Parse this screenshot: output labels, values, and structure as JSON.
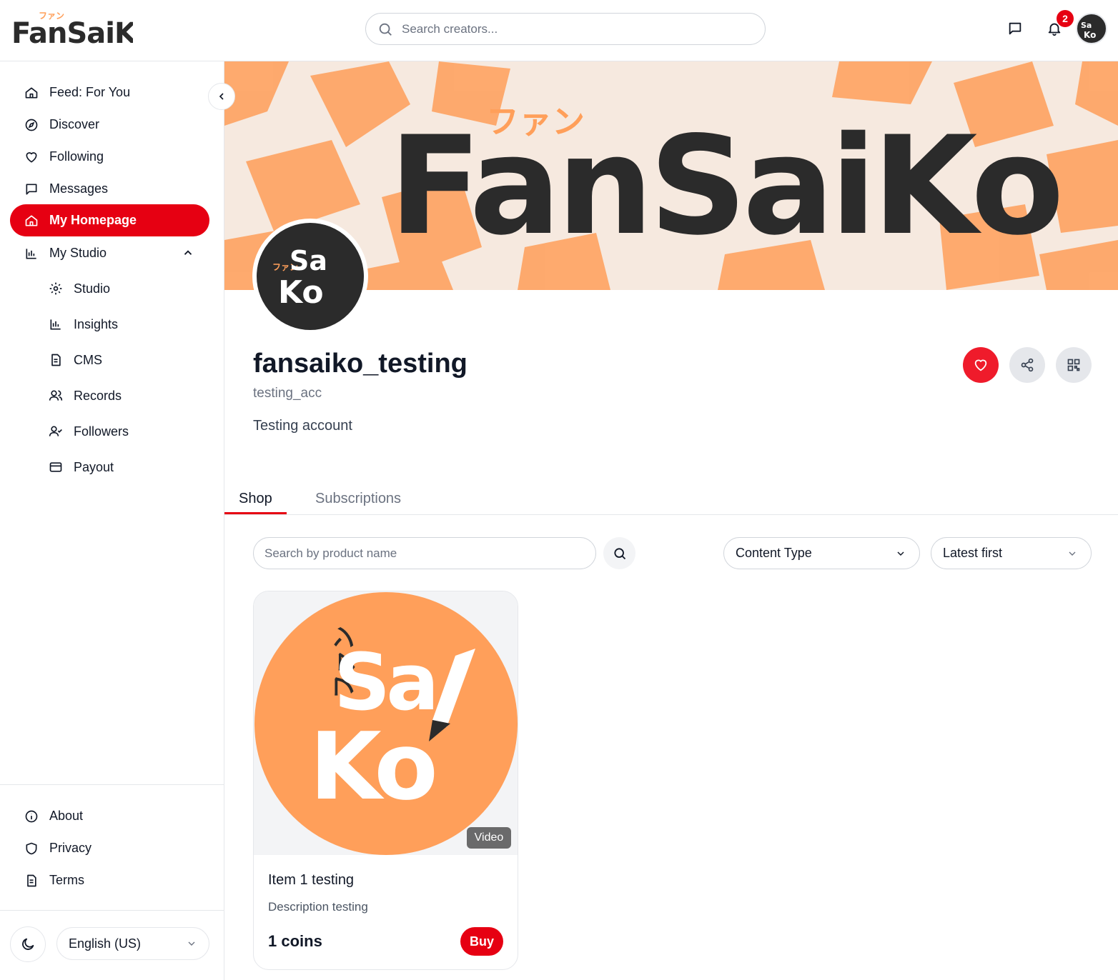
{
  "app": {
    "brand": "FanSaiKo",
    "brand_kana": "ファン"
  },
  "header": {
    "search": {
      "placeholder": "Search creators..."
    },
    "notifications_count": "2",
    "avatar_text": "SaiKo"
  },
  "sidebar": {
    "items": [
      {
        "label": "Feed: For You",
        "icon": "home-icon"
      },
      {
        "label": "Discover",
        "icon": "compass-icon"
      },
      {
        "label": "Following",
        "icon": "heart-icon"
      },
      {
        "label": "Messages",
        "icon": "message-icon"
      },
      {
        "label": "My Homepage",
        "icon": "home-icon",
        "active": true
      },
      {
        "label": "My Studio",
        "icon": "bar-chart-icon",
        "expanded": true
      }
    ],
    "studio_items": [
      {
        "label": "Studio",
        "icon": "gear-icon"
      },
      {
        "label": "Insights",
        "icon": "bar-chart-icon"
      },
      {
        "label": "CMS",
        "icon": "document-icon"
      },
      {
        "label": "Records",
        "icon": "users-icon"
      },
      {
        "label": "Followers",
        "icon": "user-check-icon"
      },
      {
        "label": "Payout",
        "icon": "credit-card-icon"
      }
    ],
    "footer_items": [
      {
        "label": "About",
        "icon": "info-icon"
      },
      {
        "label": "Privacy",
        "icon": "shield-icon"
      },
      {
        "label": "Terms",
        "icon": "document-icon"
      }
    ],
    "language": "English (US)"
  },
  "profile": {
    "display_name": "fansaiko_testing",
    "username": "testing_acc",
    "bio": "Testing account"
  },
  "tabs": [
    {
      "label": "Shop",
      "active": true
    },
    {
      "label": "Subscriptions",
      "active": false
    }
  ],
  "shop": {
    "search_placeholder": "Search by product name",
    "content_type": "Content Type",
    "sort": "Latest first",
    "products": [
      {
        "title": "Item 1 testing",
        "description": "Description testing",
        "price": "1 coins",
        "type_tag": "Video",
        "buy_label": "Buy"
      }
    ]
  },
  "colors": {
    "accent": "#e60012",
    "orange": "#ff9f5a",
    "dark": "#2b2b2b"
  }
}
